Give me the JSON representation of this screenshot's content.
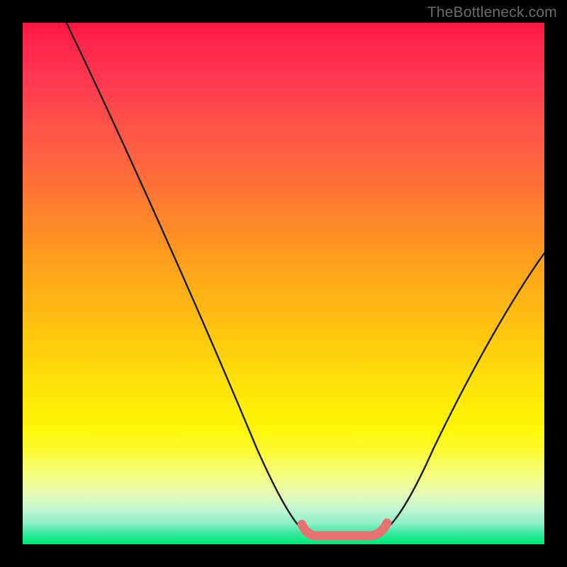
{
  "watermark": "TheBottleneck.com",
  "colors": {
    "frame": "#000000",
    "curve_stroke": "#1b1b1b",
    "salmon_band": "#e57373"
  },
  "chart_data": {
    "type": "line",
    "title": "",
    "xlabel": "",
    "ylabel": "",
    "xlim": [
      0,
      1
    ],
    "ylim": [
      0,
      1
    ],
    "series": [
      {
        "name": "bottleneck-curve",
        "x": [
          0.05,
          0.1,
          0.15,
          0.2,
          0.25,
          0.3,
          0.35,
          0.4,
          0.45,
          0.5,
          0.54,
          0.58,
          0.62,
          0.66,
          0.7,
          0.75,
          0.8,
          0.85,
          0.9,
          0.95,
          1.0
        ],
        "y": [
          1.0,
          0.94,
          0.86,
          0.78,
          0.69,
          0.59,
          0.49,
          0.38,
          0.27,
          0.15,
          0.06,
          0.02,
          0.02,
          0.02,
          0.05,
          0.12,
          0.22,
          0.32,
          0.42,
          0.51,
          0.59
        ]
      }
    ],
    "annotations": [
      {
        "name": "min-plateau-band",
        "x_range": [
          0.54,
          0.7
        ],
        "y": 0.02,
        "color": "#e57373"
      }
    ]
  }
}
